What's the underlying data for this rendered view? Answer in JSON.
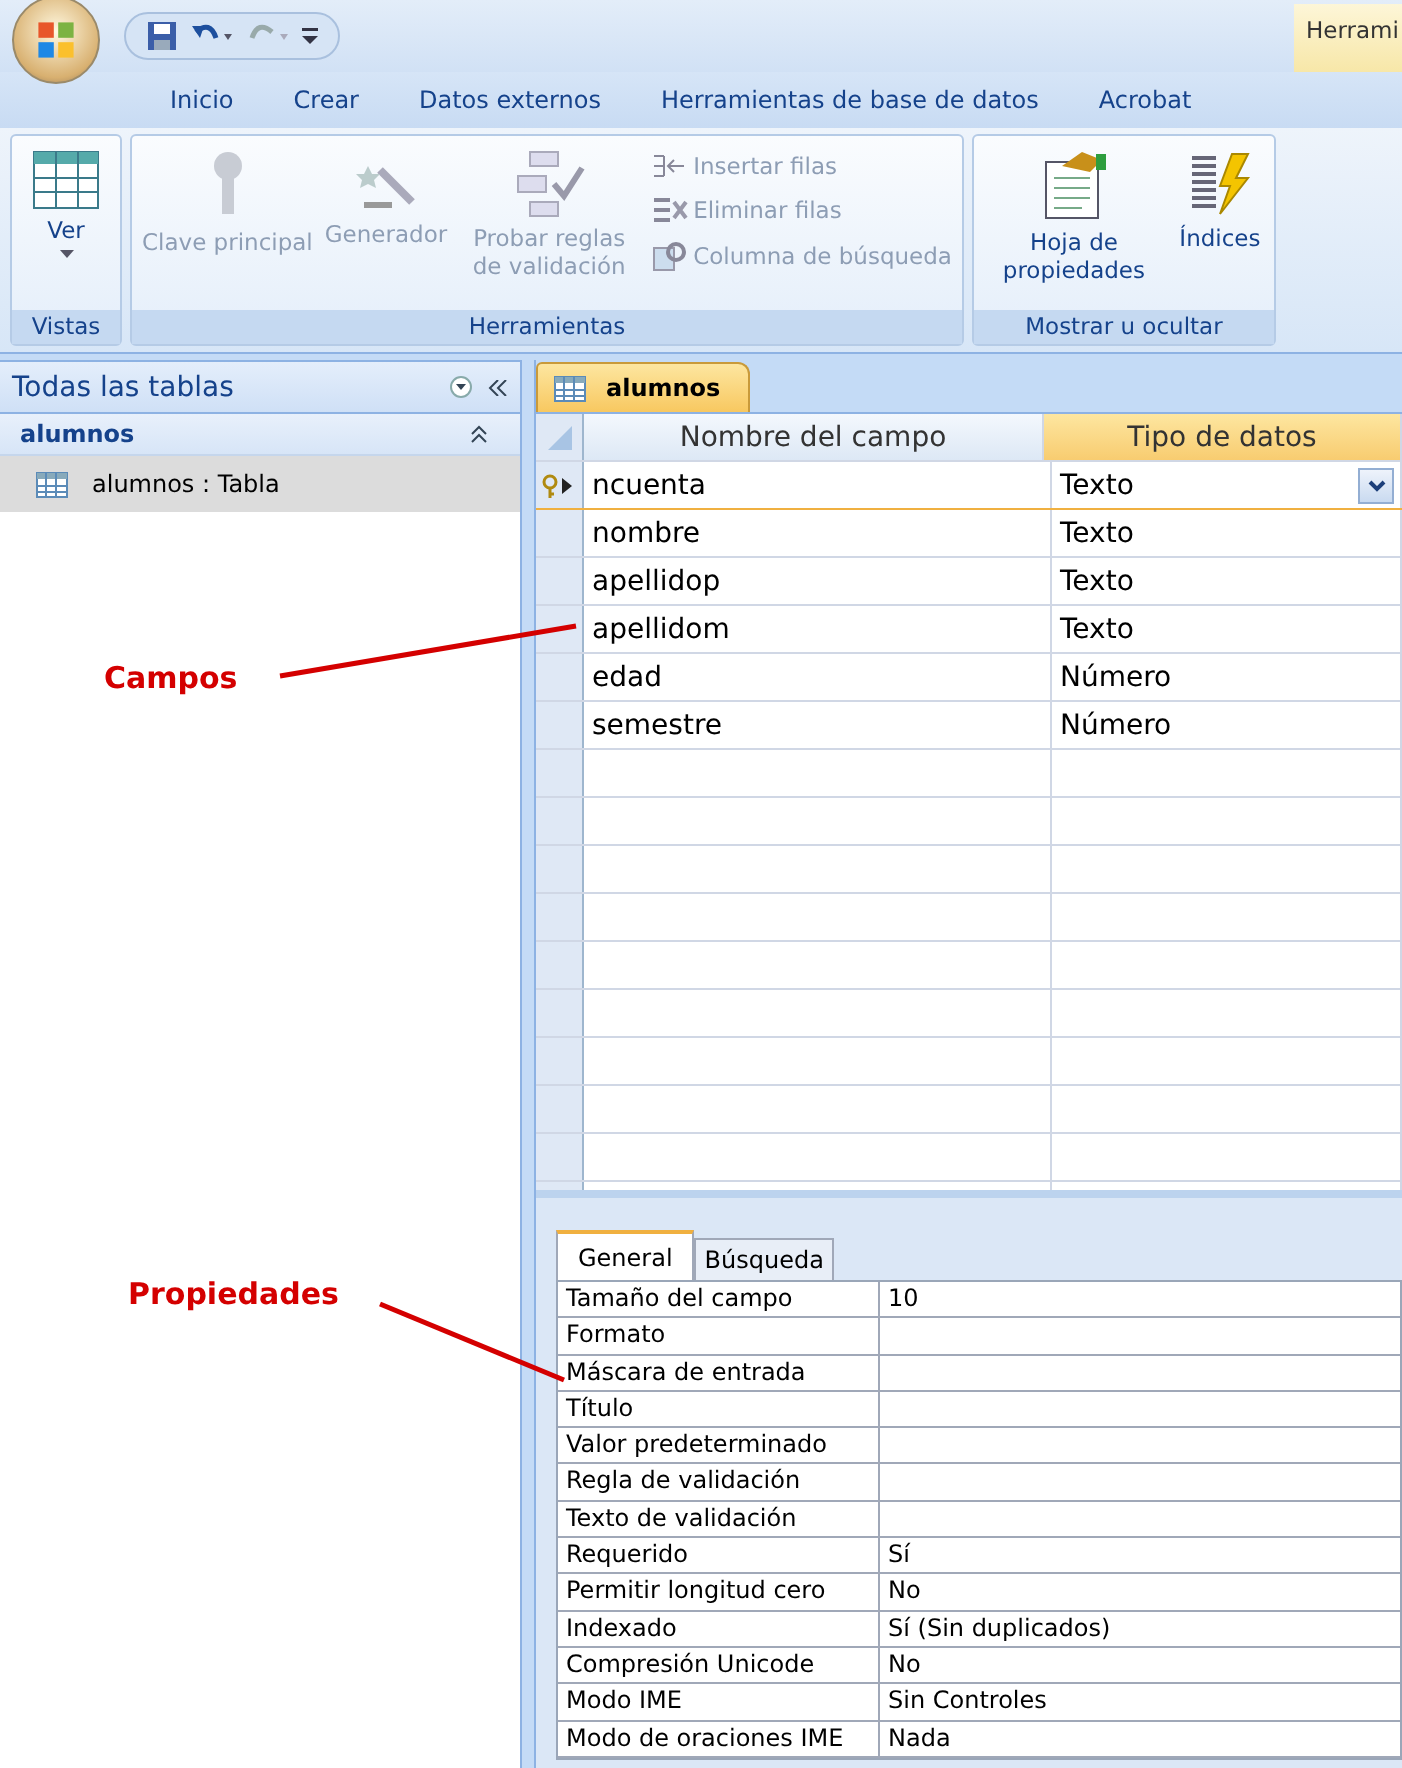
{
  "quick_access": {
    "contextual_tab": "Herrami"
  },
  "ribbon_tabs": [
    {
      "label": "Inicio",
      "selected": false
    },
    {
      "label": "Crear",
      "selected": false
    },
    {
      "label": "Datos externos",
      "selected": false
    },
    {
      "label": "Herramientas de base de datos",
      "selected": false
    },
    {
      "label": "Acrobat",
      "selected": false
    }
  ],
  "ribbon_groups": [
    {
      "label": "Vistas",
      "items": [
        {
          "kind": "large",
          "label": "Ver",
          "dropdown": true,
          "disabled": false
        }
      ]
    },
    {
      "label": "Herramientas",
      "items": [
        {
          "kind": "large",
          "label": "Clave principal",
          "dropdown": false,
          "disabled": true
        },
        {
          "kind": "large",
          "label": "Generador",
          "dropdown": false,
          "disabled": true
        },
        {
          "kind": "large",
          "label": "Probar reglas de validación",
          "dropdown": false,
          "disabled": true
        },
        {
          "kind": "small",
          "label": "Insertar filas",
          "disabled": true
        },
        {
          "kind": "small",
          "label": "Eliminar filas",
          "disabled": true
        },
        {
          "kind": "small",
          "label": "Columna de búsqueda",
          "disabled": true
        }
      ]
    },
    {
      "label": "Mostrar u ocultar",
      "items": [
        {
          "kind": "large",
          "label": "Hoja de propiedades",
          "dropdown": false,
          "disabled": false
        },
        {
          "kind": "large",
          "label": "Índices",
          "dropdown": false,
          "disabled": false
        }
      ]
    }
  ],
  "nav_pane": {
    "title": "Todas las tablas",
    "groups": [
      {
        "label": "alumnos",
        "expanded": true,
        "items": [
          {
            "label": "alumnos : Tabla",
            "selected": true
          }
        ]
      }
    ]
  },
  "document_tab": {
    "label": "alumnos"
  },
  "design_grid": {
    "columns": [
      "Nombre del campo",
      "Tipo de datos"
    ],
    "rows": [
      {
        "name": "ncuenta",
        "type": "Texto",
        "primary_key": true,
        "selected": true
      },
      {
        "name": "nombre",
        "type": "Texto",
        "primary_key": false,
        "selected": false
      },
      {
        "name": "apellidop",
        "type": "Texto",
        "primary_key": false,
        "selected": false
      },
      {
        "name": "apellidom",
        "type": "Texto",
        "primary_key": false,
        "selected": false
      },
      {
        "name": "edad",
        "type": "Número",
        "primary_key": false,
        "selected": false
      },
      {
        "name": "semestre",
        "type": "Número",
        "primary_key": false,
        "selected": false
      }
    ]
  },
  "properties": {
    "tabs": [
      {
        "label": "General",
        "selected": true
      },
      {
        "label": "Búsqueda",
        "selected": false
      }
    ],
    "rows": [
      {
        "label": "Tamaño del campo",
        "value": "10"
      },
      {
        "label": "Formato"
      },
      {
        "label": "Máscara de entrada"
      },
      {
        "label": "Título"
      },
      {
        "label": "Valor predeterminado"
      },
      {
        "label": "Regla de validación"
      },
      {
        "label": "Texto de validación"
      },
      {
        "label": "Requerido",
        "value": "Sí"
      },
      {
        "label": "Permitir longitud cero",
        "value": "No"
      },
      {
        "label": "Indexado",
        "value": "Sí (Sin duplicados)"
      },
      {
        "label": "Compresión Unicode",
        "value": "No"
      },
      {
        "label": "Modo IME",
        "value": "Sin Controles"
      },
      {
        "label": "Modo de oraciones IME",
        "value": "Nada"
      }
    ]
  },
  "annotations": [
    {
      "label": "Campos"
    },
    {
      "label": "Propiedades"
    }
  ]
}
